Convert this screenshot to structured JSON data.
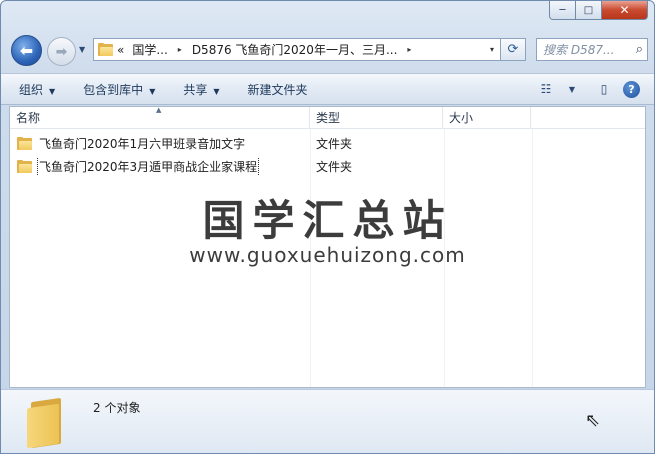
{
  "window": {
    "min_label": "─",
    "max_label": "□",
    "close_label": "✕"
  },
  "nav": {
    "back_glyph": "⬅",
    "forward_glyph": "➡",
    "history_glyph": "▼",
    "address": {
      "chevrons": "«",
      "segment1": "国学...",
      "segment2": "D5876 飞鱼奇门2020年一月、三月...",
      "arrow": "▸",
      "dropdown": "▾"
    },
    "refresh_glyph": "⟳",
    "search_placeholder": "搜索 D587...",
    "search_glyph": "⌕"
  },
  "toolbar": {
    "organize": "组织",
    "include_in_library": "包含到库中",
    "share": "共享",
    "new_folder": "新建文件夹",
    "caret": "▼",
    "view_glyph": "☷",
    "preview_glyph": "▯",
    "help_glyph": "?"
  },
  "columns": {
    "name": "名称",
    "type": "类型",
    "size": "大小",
    "sort_glyph": "▲"
  },
  "files": [
    {
      "name": "飞鱼奇门2020年1月六甲班录音加文字",
      "type": "文件夹",
      "size": ""
    },
    {
      "name": "飞鱼奇门2020年3月遁甲商战企业家课程",
      "type": "文件夹",
      "size": ""
    }
  ],
  "watermark": {
    "title": "国学汇总站",
    "url": "www.guoxuehuizong.com"
  },
  "status": {
    "count": "2 个对象",
    "cursor_glyph": "⇖"
  },
  "colors": {
    "accent": "#2d63b8",
    "folder": "#f1c95e",
    "close": "#c94a2f"
  }
}
